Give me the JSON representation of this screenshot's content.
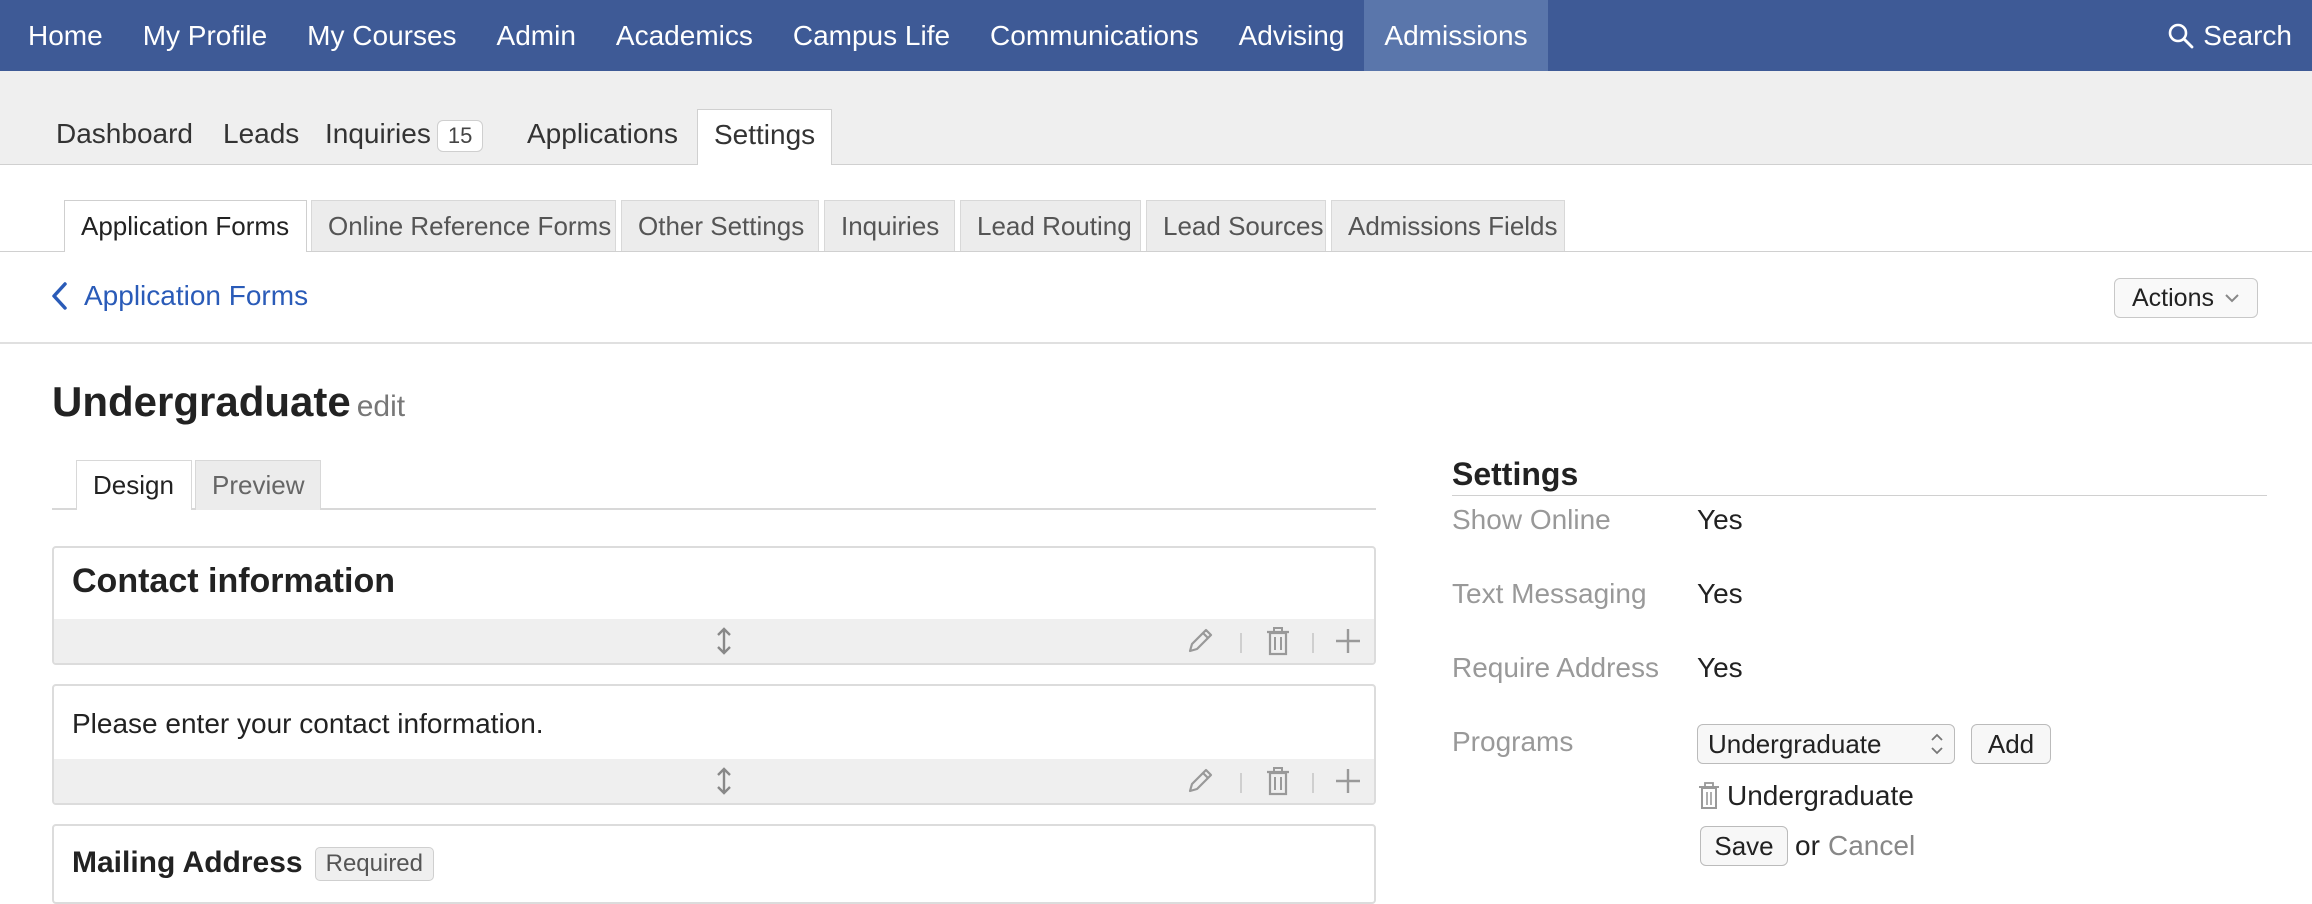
{
  "topnav": {
    "items": [
      "Home",
      "My Profile",
      "My Courses",
      "Admin",
      "Academics",
      "Campus Life",
      "Communications",
      "Advising",
      "Admissions"
    ],
    "active_index": 8,
    "search_label": "Search"
  },
  "subnav": {
    "dashboard": "Dashboard",
    "leads": "Leads",
    "inquiries": "Inquiries",
    "inquiries_count": "15",
    "applications": "Applications",
    "settings": "Settings"
  },
  "settings_tabs": [
    "Application Forms",
    "Online Reference Forms",
    "Other Settings",
    "Inquiries",
    "Lead Routing",
    "Lead Sources",
    "Admissions Fields"
  ],
  "breadcrumb": {
    "back_label": "Application Forms",
    "actions_label": "Actions"
  },
  "form": {
    "title": "Undergraduate",
    "edit_label": "edit",
    "design_tab": "Design",
    "preview_tab": "Preview",
    "blocks": {
      "contact_heading": "Contact information",
      "contact_text": "Please enter your contact information.",
      "mailing_heading": "Mailing Address",
      "required_badge": "Required"
    }
  },
  "settings_panel": {
    "title": "Settings",
    "show_online_label": "Show Online",
    "show_online_value": "Yes",
    "text_messaging_label": "Text Messaging",
    "text_messaging_value": "Yes",
    "require_address_label": "Require Address",
    "require_address_value": "Yes",
    "programs_label": "Programs",
    "program_select_value": "Undergraduate",
    "add_button": "Add",
    "program_item": "Undergraduate",
    "save_button": "Save",
    "or_text": "or",
    "cancel_link": "Cancel"
  },
  "colors": {
    "topnav_bg": "#3e5a96",
    "topnav_active": "#5a76ab",
    "link": "#2a5bb8"
  }
}
